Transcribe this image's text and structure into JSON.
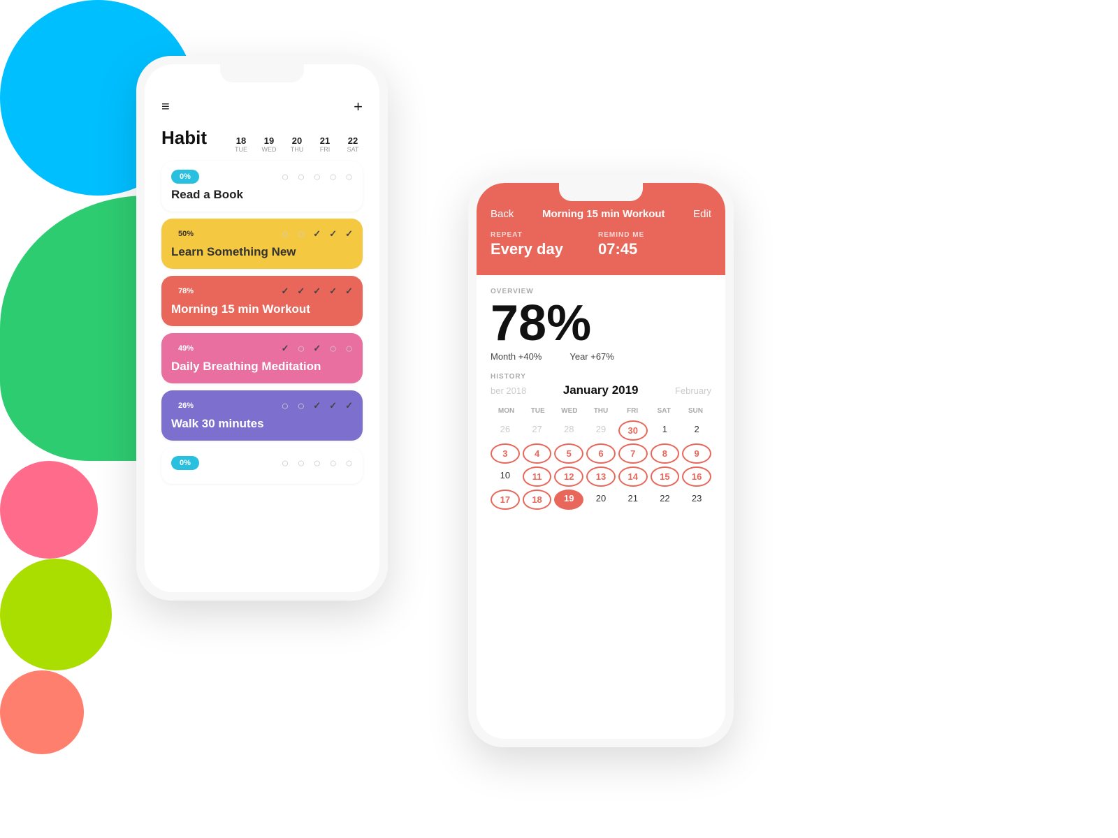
{
  "background": {
    "colors": {
      "cyan": "#00BFFF",
      "green": "#2ECC71",
      "pink": "#FF6B8A",
      "lime": "#AADD00",
      "salmon": "#FF7F6E"
    }
  },
  "phone1": {
    "header": {
      "hamburger": "≡",
      "plus": "+"
    },
    "title": "Habit",
    "dates": [
      {
        "num": "18",
        "day": "TUE"
      },
      {
        "num": "19",
        "day": "WED"
      },
      {
        "num": "20",
        "day": "THU"
      },
      {
        "num": "21",
        "day": "FRI"
      },
      {
        "num": "22",
        "day": "SAT"
      }
    ],
    "habits": [
      {
        "id": "read-a-book",
        "label": "Read a Book",
        "badge": "0%",
        "badge_color": "cyan",
        "card_color": "none",
        "checks": [
          "dot",
          "dot",
          "dot",
          "dot",
          "dot"
        ]
      },
      {
        "id": "learn-something-new",
        "label": "Learn Something New",
        "badge": "50%",
        "badge_color": "yellow",
        "card_color": "yellow",
        "checks": [
          "dot",
          "dot",
          "check",
          "check",
          "check"
        ]
      },
      {
        "id": "morning-workout",
        "label": "Morning 15 min Workout",
        "badge": "78%",
        "badge_color": "red",
        "card_color": "red",
        "checks": [
          "check",
          "check",
          "check",
          "check",
          "check"
        ]
      },
      {
        "id": "daily-breathing",
        "label": "Daily Breathing Meditation",
        "badge": "49%",
        "badge_color": "pink",
        "card_color": "pink",
        "checks": [
          "check",
          "dot",
          "check",
          "dot",
          "dot"
        ]
      },
      {
        "id": "walk-30",
        "label": "Walk 30 minutes",
        "badge": "26%",
        "badge_color": "purple",
        "card_color": "purple",
        "checks": [
          "dot",
          "dot",
          "check",
          "check",
          "check"
        ]
      },
      {
        "id": "habit6",
        "label": "",
        "badge": "0%",
        "badge_color": "cyan2",
        "card_color": "none",
        "checks": [
          "dot",
          "dot",
          "dot",
          "dot",
          "dot"
        ]
      }
    ]
  },
  "phone2": {
    "nav": {
      "back": "Back",
      "title": "Morning 15 min Workout",
      "edit": "Edit"
    },
    "repeat_label": "REPEAT",
    "repeat_value": "Every day",
    "remind_label": "REMIND ME",
    "remind_value": "07:45",
    "overview_label": "OVERVIEW",
    "overview_percent": "78%",
    "month_stat": "Month +40%",
    "year_stat": "Year +67%",
    "history_label": "HISTORY",
    "calendar": {
      "prev_month": "ber 2018",
      "current_month": "January 2019",
      "next_month": "February",
      "day_names": [
        "MON",
        "TUE",
        "WED",
        "THU",
        "FRI",
        "SAT",
        "SUN"
      ],
      "rows": [
        [
          {
            "num": "26",
            "style": "dim"
          },
          {
            "num": "27",
            "style": "dim"
          },
          {
            "num": "28",
            "style": "dim"
          },
          {
            "num": "29",
            "style": "dim"
          },
          {
            "num": "30",
            "style": "circled"
          },
          {
            "num": "1",
            "style": "normal"
          },
          {
            "num": "2",
            "style": "normal"
          }
        ],
        [
          {
            "num": "3",
            "style": "circled"
          },
          {
            "num": "4",
            "style": "circled"
          },
          {
            "num": "5",
            "style": "circled"
          },
          {
            "num": "6",
            "style": "circled"
          },
          {
            "num": "7",
            "style": "circled"
          },
          {
            "num": "8",
            "style": "circled"
          },
          {
            "num": "9",
            "style": "circled"
          }
        ],
        [
          {
            "num": "10",
            "style": "normal"
          },
          {
            "num": "11",
            "style": "circled"
          },
          {
            "num": "12",
            "style": "circled"
          },
          {
            "num": "13",
            "style": "circled"
          },
          {
            "num": "14",
            "style": "circled"
          },
          {
            "num": "15",
            "style": "circled"
          },
          {
            "num": "16",
            "style": "circled"
          }
        ],
        [
          {
            "num": "17",
            "style": "circled"
          },
          {
            "num": "18",
            "style": "circled"
          },
          {
            "num": "19",
            "style": "filled"
          },
          {
            "num": "20",
            "style": "normal"
          },
          {
            "num": "21",
            "style": "normal"
          },
          {
            "num": "22",
            "style": "normal"
          },
          {
            "num": "23",
            "style": "normal"
          }
        ]
      ]
    }
  }
}
